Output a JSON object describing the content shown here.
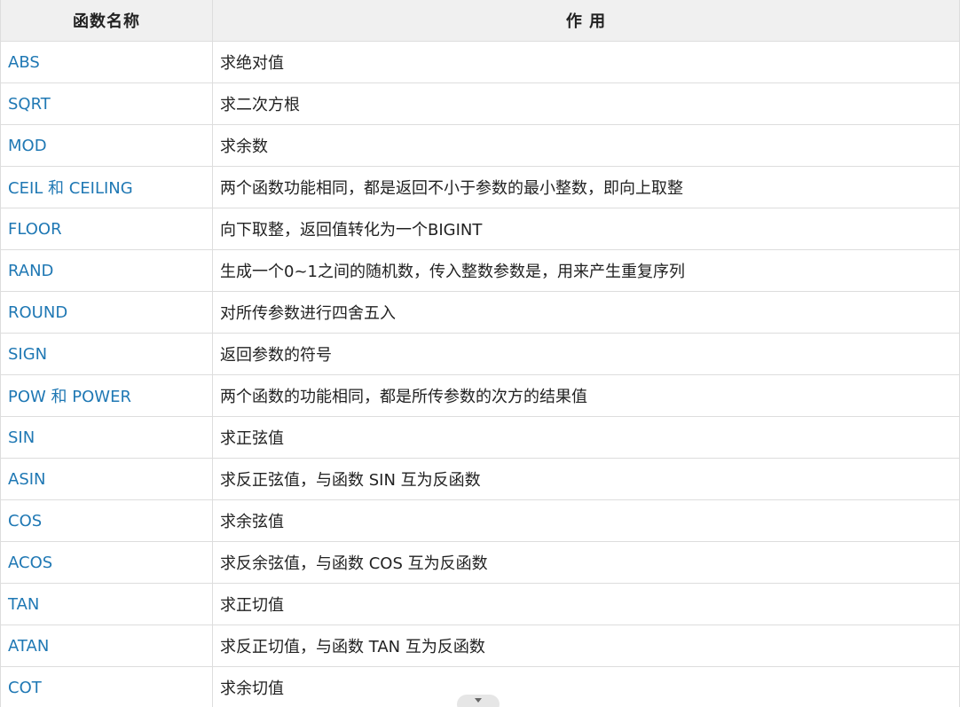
{
  "table": {
    "headers": [
      "函数名称",
      "作 用"
    ],
    "rows": [
      {
        "name": "ABS",
        "desc": "求绝对值"
      },
      {
        "name": "SQRT",
        "desc": "求二次方根"
      },
      {
        "name": "MOD",
        "desc": "求余数"
      },
      {
        "name": "CEIL 和 CEILING",
        "desc": "两个函数功能相同，都是返回不小于参数的最小整数，即向上取整"
      },
      {
        "name": "FLOOR",
        "desc": "向下取整，返回值转化为一个BIGINT"
      },
      {
        "name": "RAND",
        "desc": "生成一个0~1之间的随机数，传入整数参数是，用来产生重复序列"
      },
      {
        "name": "ROUND",
        "desc": "对所传参数进行四舍五入"
      },
      {
        "name": "SIGN",
        "desc": "返回参数的符号"
      },
      {
        "name": "POW 和 POWER",
        "desc": "两个函数的功能相同，都是所传参数的次方的结果值"
      },
      {
        "name": "SIN",
        "desc": "求正弦值"
      },
      {
        "name": "ASIN",
        "desc": "求反正弦值，与函数 SIN 互为反函数"
      },
      {
        "name": "COS",
        "desc": "求余弦值"
      },
      {
        "name": "ACOS",
        "desc": "求反余弦值，与函数 COS 互为反函数"
      },
      {
        "name": "TAN",
        "desc": "求正切值"
      },
      {
        "name": "ATAN",
        "desc": "求反正切值，与函数 TAN 互为反函数"
      },
      {
        "name": "COT",
        "desc": "求余切值"
      }
    ]
  },
  "controls": {
    "expand_icon": "chevron-down-icon"
  }
}
